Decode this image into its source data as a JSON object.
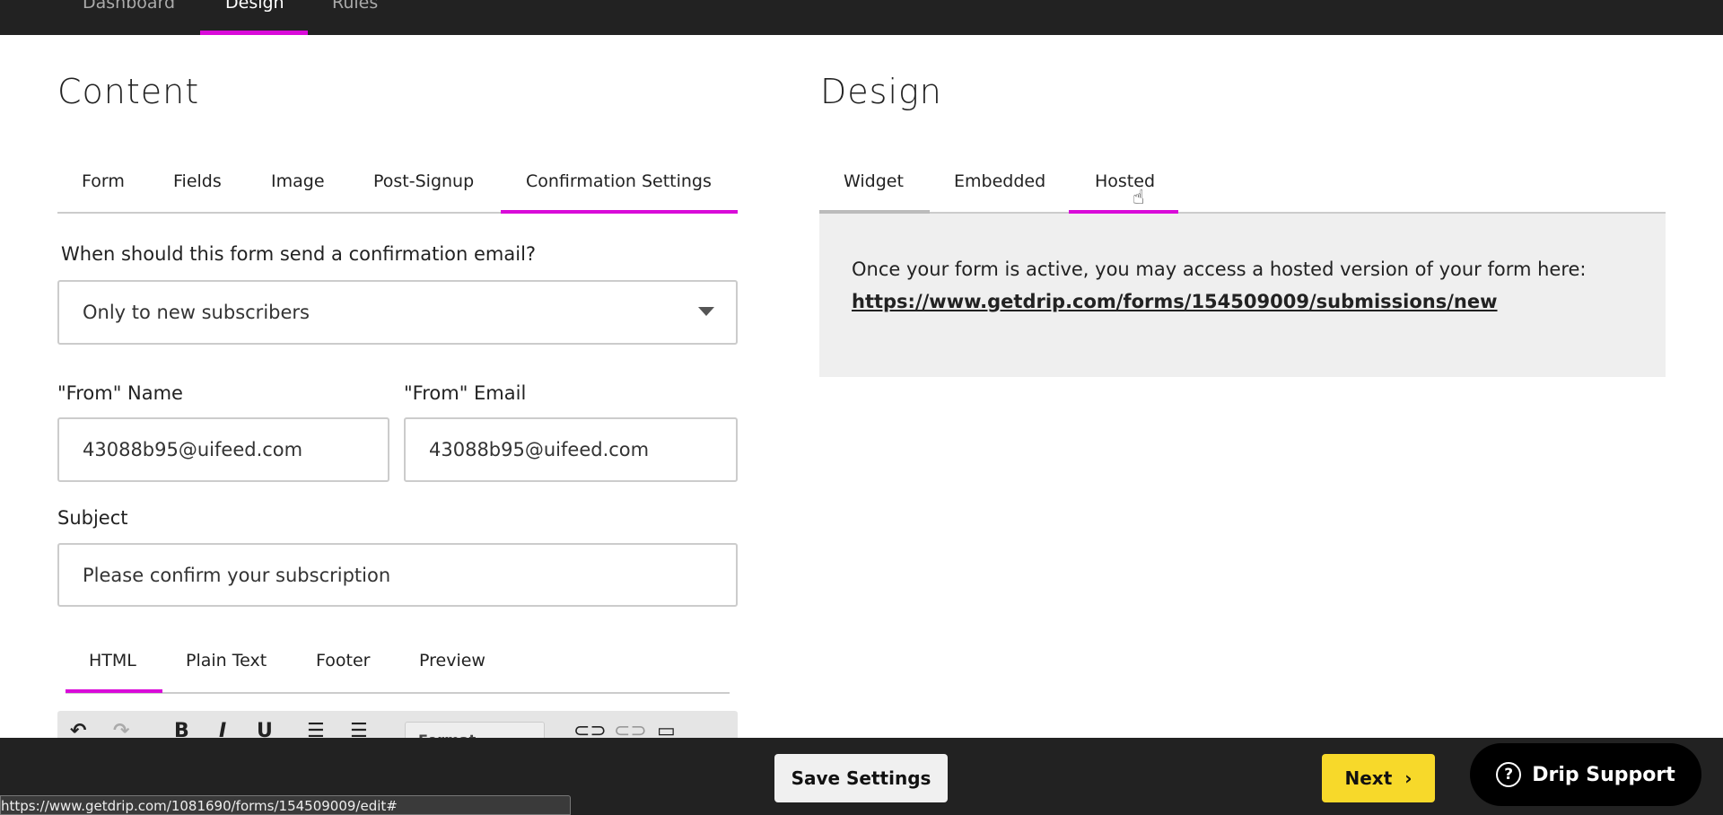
{
  "topnav": {
    "tabs": [
      "Dashboard",
      "Design",
      "Rules"
    ],
    "active": "Design"
  },
  "content": {
    "title": "Content",
    "tabs": [
      "Form",
      "Fields",
      "Image",
      "Post-Signup",
      "Confirmation Settings"
    ],
    "active_tab": "Confirmation Settings",
    "question": "When should this form send a confirmation email?",
    "send_select": "Only to new subscribers",
    "from_name_label": "\"From\" Name",
    "from_name_value": "43088b95@uifeed.com",
    "from_email_label": "\"From\" Email",
    "from_email_value": "43088b95@uifeed.com",
    "subject_label": "Subject",
    "subject_value": "Please confirm your subscription",
    "editor_tabs": [
      "HTML",
      "Plain Text",
      "Footer",
      "Preview"
    ],
    "editor_active": "HTML",
    "toolbar": {
      "undo": "↶",
      "redo": "↷",
      "bold": "B",
      "italic": "I",
      "underline": "U",
      "bullets": "☰",
      "numbers": "☰",
      "format": "Format"
    }
  },
  "design": {
    "title": "Design",
    "tabs": [
      "Widget",
      "Embedded",
      "Hosted"
    ],
    "active_tab": "Hosted",
    "hosted_text": "Once your form is active, you may access a hosted version of your form here:",
    "hosted_link": "https://www.getdrip.com/forms/154509009/submissions/new"
  },
  "footer": {
    "save": "Save Settings",
    "next": "Next",
    "support": "Drip Support"
  },
  "status_url": "https://www.getdrip.com/1081690/forms/154509009/edit#",
  "colors": {
    "accent": "#d90ad9",
    "next": "#f7d92a",
    "bar": "#222222"
  }
}
